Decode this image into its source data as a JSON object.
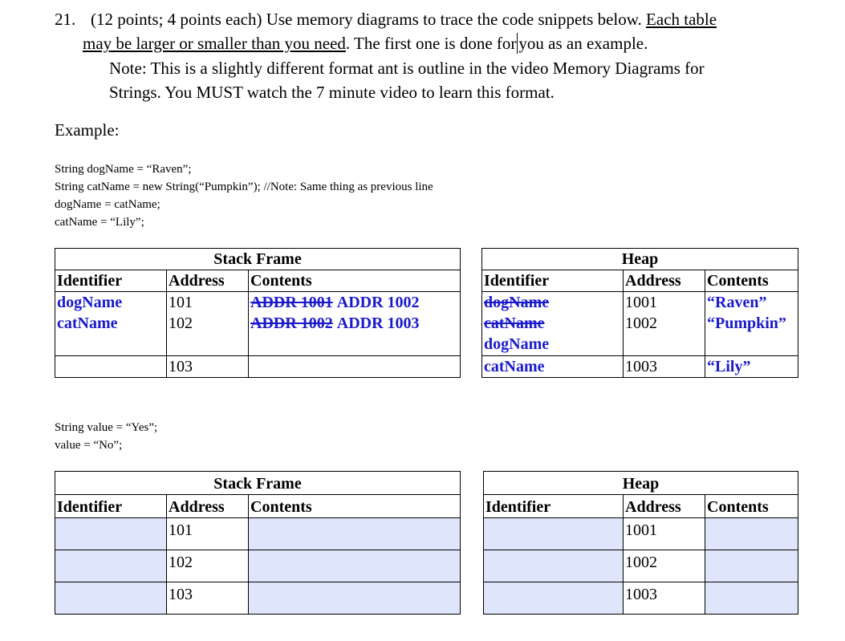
{
  "question": {
    "number": "21.",
    "line1_pre": "(12 points; 4 points each) Use memory diagrams to trace the code snippets below. ",
    "line1_u": "Each table",
    "line2_u": "may be larger or smaller than you need",
    "line2_a": ". The first one is done for",
    "line2_b": "you as an example.",
    "note1": "Note:  This is a slightly different format ant is outline in the video Memory Diagrams for",
    "note2": "Strings.  You MUST watch the 7 minute video to learn this format."
  },
  "example": {
    "label": "Example:",
    "code": [
      "String dogName = “Raven”;",
      "String catName = new String(“Pumpkin”);   //Note: Same thing as previous line",
      "dogName = catName;",
      "catName = “Lily”;"
    ],
    "stack": {
      "title": "Stack Frame",
      "headers": [
        "Identifier",
        "Address",
        "Contents"
      ],
      "rows": [
        {
          "id": "dogName",
          "addr": "101",
          "old": "ADDR 1001",
          "new": "ADDR 1002"
        },
        {
          "id": "catName",
          "addr": "102",
          "old": "ADDR 1002",
          "new": "ADDR 1003"
        },
        {
          "id": "",
          "addr": "103",
          "old": "",
          "new": ""
        }
      ]
    },
    "heap": {
      "title": "Heap",
      "headers": [
        "Identifier",
        "Address",
        "Contents"
      ],
      "rows": [
        {
          "ids_struck": [
            "dogName"
          ],
          "ids": [],
          "addr": "1001",
          "contents": "“Raven”"
        },
        {
          "ids_struck": [
            "catName"
          ],
          "ids": [
            "dogName"
          ],
          "addr": "1002",
          "contents": "“Pumpkin”"
        },
        {
          "ids_struck": [],
          "ids": [
            "catName"
          ],
          "addr": "1003",
          "contents": "“Lily”"
        }
      ]
    }
  },
  "problem2": {
    "code": [
      "String value = “Yes”;",
      "value = “No”;"
    ],
    "stack": {
      "title": "Stack Frame",
      "headers": [
        "Identifier",
        "Address",
        "Contents"
      ],
      "addresses": [
        "101",
        "102",
        "103"
      ]
    },
    "heap": {
      "title": "Heap",
      "headers": [
        "Identifier",
        "Address",
        "Contents"
      ],
      "addresses": [
        "1001",
        "1002",
        "1003"
      ]
    }
  },
  "colors": {
    "answer_blue": "#1a1acc",
    "input_fill": "#dfe6fb"
  }
}
